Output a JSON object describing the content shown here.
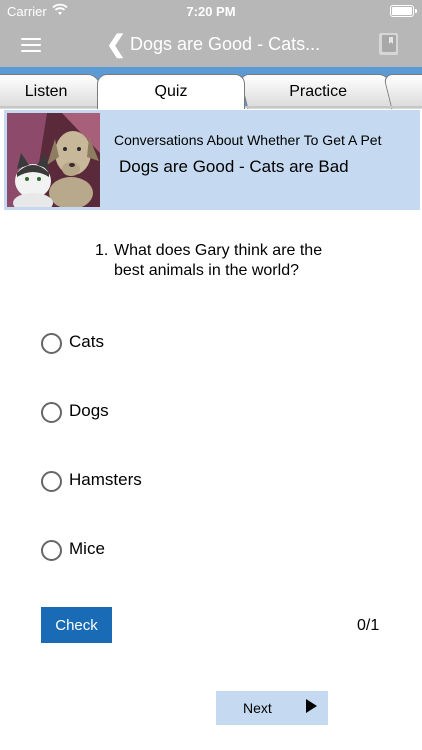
{
  "status_bar": {
    "carrier": "Carrier",
    "time": "7:20 PM"
  },
  "nav": {
    "title": "Dogs are Good - Cats..."
  },
  "tabs": [
    {
      "label": "Listen"
    },
    {
      "label": "Quiz"
    },
    {
      "label": "Practice"
    },
    {
      "label": ""
    }
  ],
  "lesson": {
    "subtitle": "Conversations About Whether To Get A Pet",
    "title": "Dogs are Good - Cats are Bad"
  },
  "question": {
    "number": "1.",
    "text": "What does Gary think are the best animals in the world?"
  },
  "options": [
    {
      "label": "Cats"
    },
    {
      "label": "Dogs"
    },
    {
      "label": "Hamsters"
    },
    {
      "label": "Mice"
    }
  ],
  "check_label": "Check",
  "score": "0/1",
  "next_label": "Next",
  "colors": {
    "accent": "#1a6bb5",
    "header_bg": "#c5daf0",
    "nav_bg": "#b7b7b7",
    "tab_strip": "#5b9bd5"
  }
}
